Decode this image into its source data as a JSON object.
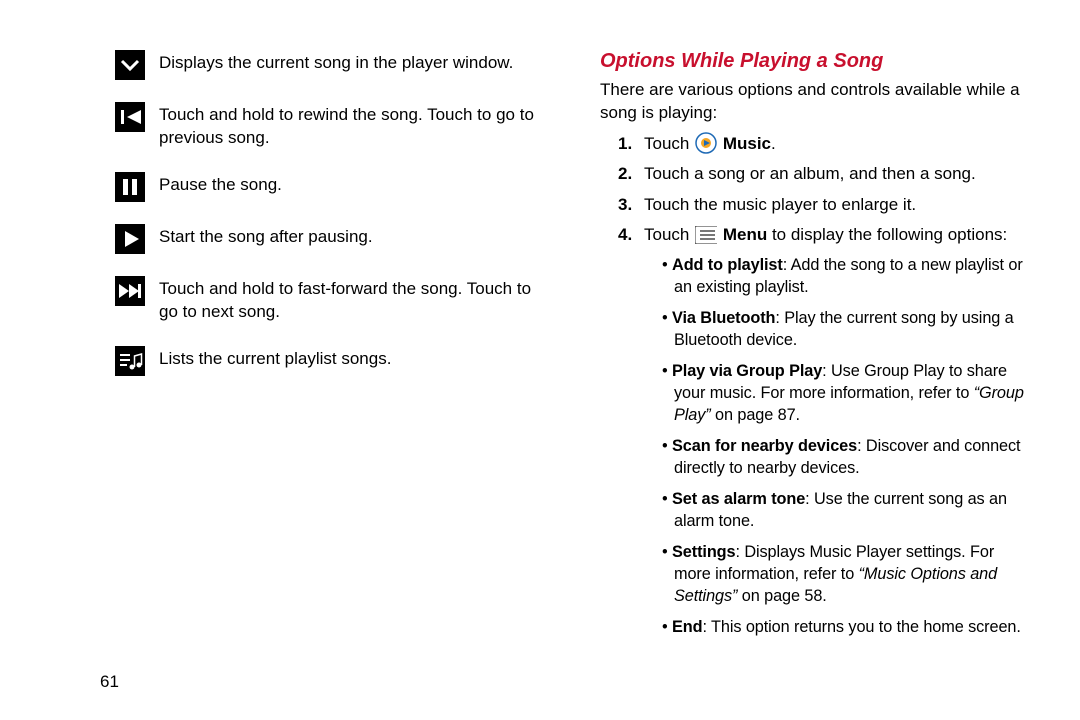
{
  "page_number": "61",
  "left_items": [
    {
      "icon": "chevron-down-icon",
      "text": "Displays the current song in the player window."
    },
    {
      "icon": "previous-icon",
      "text": "Touch and hold to rewind the song. Touch to go to previous song."
    },
    {
      "icon": "pause-icon",
      "text": "Pause the song."
    },
    {
      "icon": "play-icon",
      "text": "Start the song after pausing."
    },
    {
      "icon": "next-icon",
      "text": "Touch and hold to fast-forward  the song. Touch to go to next song."
    },
    {
      "icon": "playlist-icon",
      "text": "Lists the current playlist songs."
    }
  ],
  "right": {
    "heading": "Options While Playing a Song",
    "intro": "There are various options and controls available while a song is playing:",
    "steps": {
      "s1_prefix": "Touch ",
      "s1_bold": "Music",
      "s1_suffix": ".",
      "s2": "Touch a song or an album, and then a song.",
      "s3": "Touch the music player to enlarge it.",
      "s4_prefix": "Touch ",
      "s4_bold": "Menu",
      "s4_suffix": " to display the following options:"
    },
    "bullets": {
      "b1_bold": "Add to playlist",
      "b1_rest": ": Add the song to a new playlist or an existing playlist.",
      "b2_bold": "Via Bluetooth",
      "b2_rest": ": Play the current song by using a Bluetooth device.",
      "b3_bold": "Play via Group Play",
      "b3_rest1": ": Use Group Play to share your music. For more information, refer to ",
      "b3_ital": "“Group Play”",
      "b3_rest2": " on page 87.",
      "b4_bold": "Scan for nearby devices",
      "b4_rest": ": Discover and connect directly to nearby devices.",
      "b5_bold": "Set as alarm tone",
      "b5_rest": ": Use the current song as an alarm tone.",
      "b6_bold": "Settings",
      "b6_rest1": ": Displays Music Player settings. For more information, refer to ",
      "b6_ital": "“Music Options and Settings”",
      "b6_rest2": " on page 58.",
      "b7_bold": "End",
      "b7_rest": ": This option returns you to the home screen."
    }
  }
}
